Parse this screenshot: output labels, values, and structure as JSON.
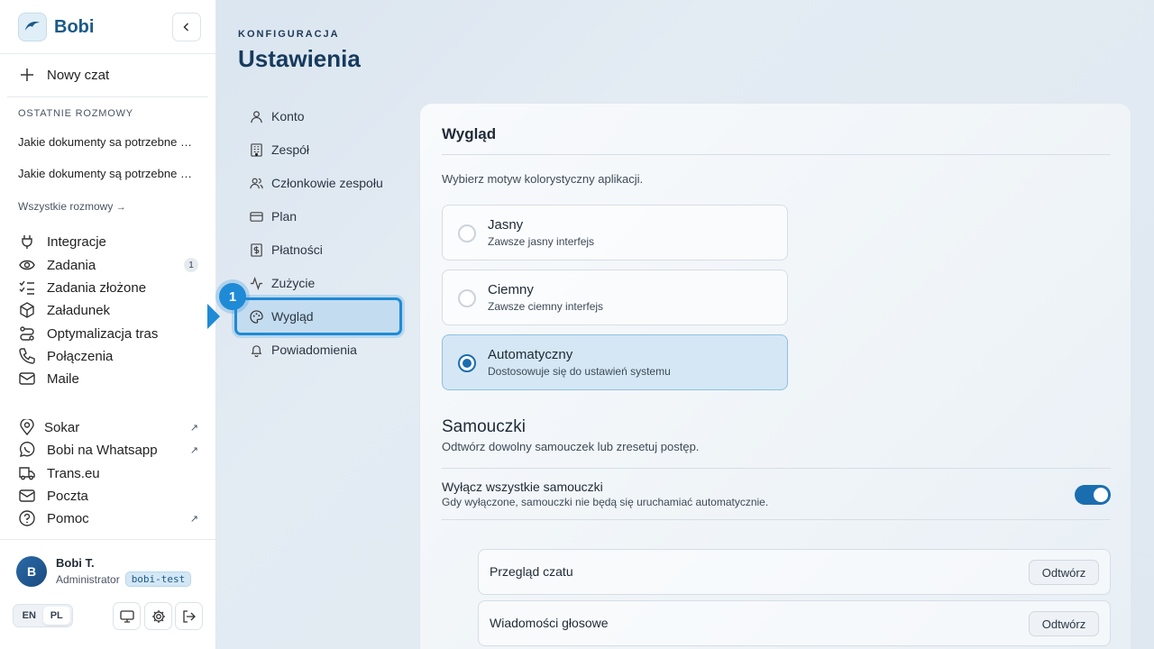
{
  "brand": {
    "name": "Bobi"
  },
  "sidebar": {
    "new_chat": "Nowy czat",
    "recent_label": "OSTATNIE ROZMOWY",
    "recent": [
      "Jakie dokumenty sa potrzebne do przewozu towaru",
      "Jakie dokumenty są potrzebne do przewozu towaru"
    ],
    "all_chats": "Wszystkie rozmowy",
    "nav": [
      {
        "label": "Integracje",
        "icon": "plug-icon"
      },
      {
        "label": "Zadania",
        "icon": "eye-icon",
        "badge": "1"
      },
      {
        "label": "Zadania złożone",
        "icon": "list-check-icon"
      },
      {
        "label": "Załadunek",
        "icon": "package-icon"
      },
      {
        "label": "Optymalizacja tras",
        "icon": "route-icon"
      },
      {
        "label": "Połączenia",
        "icon": "phone-icon"
      },
      {
        "label": "Maile",
        "icon": "mail-icon"
      }
    ],
    "external": [
      {
        "label": "Sokar",
        "icon": "map-pin-icon",
        "external": true
      },
      {
        "label": "Bobi na Whatsapp",
        "icon": "whatsapp-icon",
        "external": true
      },
      {
        "label": "Trans.eu",
        "icon": "truck-icon",
        "external": false
      },
      {
        "label": "Poczta",
        "icon": "mail-icon",
        "external": false
      },
      {
        "label": "Pomoc",
        "icon": "help-circle-icon",
        "external": true
      }
    ],
    "user": {
      "initial": "B",
      "name": "Bobi T.",
      "role": "Administrator",
      "tag": "bobi-test"
    },
    "lang": {
      "options": [
        "EN",
        "PL"
      ],
      "selected": "PL"
    }
  },
  "header": {
    "eyebrow": "KONFIGURACJA",
    "title": "Ustawienia"
  },
  "settings_nav": [
    {
      "label": "Konto",
      "icon": "user-icon"
    },
    {
      "label": "Zespół",
      "icon": "building-icon"
    },
    {
      "label": "Członkowie zespołu",
      "icon": "users-icon"
    },
    {
      "label": "Plan",
      "icon": "credit-card-icon"
    },
    {
      "label": "Płatności",
      "icon": "receipt-icon"
    },
    {
      "label": "Zużycie",
      "icon": "activity-icon"
    },
    {
      "label": "Wygląd",
      "icon": "palette-icon",
      "active": true
    },
    {
      "label": "Powiadomienia",
      "icon": "bell-icon"
    }
  ],
  "tour": {
    "step": "1"
  },
  "appearance": {
    "title": "Wygląd",
    "description": "Wybierz motyw kolorystyczny aplikacji.",
    "options": [
      {
        "title": "Jasny",
        "subtitle": "Zawsze jasny interfejs",
        "selected": false
      },
      {
        "title": "Ciemny",
        "subtitle": "Zawsze ciemny interfejs",
        "selected": false
      },
      {
        "title": "Automatyczny",
        "subtitle": "Dostosowuje się do ustawień systemu",
        "selected": true
      }
    ]
  },
  "tutorials": {
    "title": "Samouczki",
    "description": "Odtwórz dowolny samouczek lub zresetuj postęp.",
    "toggle_title": "Wyłącz wszystkie samouczki",
    "toggle_subtitle": "Gdy wyłączone, samouczki nie będą się uruchamiać automatycznie.",
    "toggle_on": true,
    "items": [
      {
        "name": "Przegląd czatu",
        "action": "Odtwórz"
      },
      {
        "name": "Wiadomości głosowe",
        "action": "Odtwórz"
      }
    ]
  },
  "colors": {
    "accent": "#1a6eb0",
    "highlight": "#1f8ad6",
    "brand": "#1a5a8a"
  }
}
